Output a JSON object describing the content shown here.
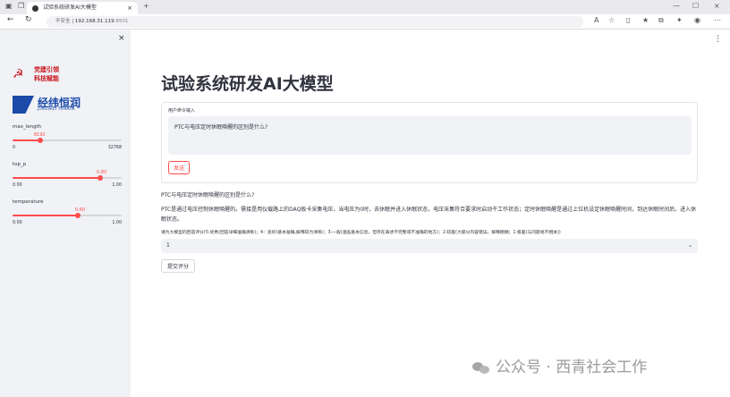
{
  "browser": {
    "tab_title": "试验系统研发AI大模型",
    "tab_close": "×",
    "url_security": "不安全",
    "url_host": "192.168.31.119",
    "url_port": ":8501",
    "nav_back": "←",
    "nav_reload": "↻",
    "win_min": "—",
    "win_max": "☐",
    "win_close": "×"
  },
  "sidebar": {
    "close": "×",
    "logo1_line1": "党建引领",
    "logo1_line2": "科技赋能",
    "logo1_icon": "☭",
    "logo2_name": "经纬恒润",
    "logo2_en": "JINGWEI HIRAIN",
    "sliders": [
      {
        "label": "max_length",
        "value": "8192",
        "min": "0",
        "max": "32768",
        "fraction": 0.25
      },
      {
        "label": "top_p",
        "value": "0.80",
        "min": "0.00",
        "max": "1.00",
        "fraction": 0.8
      },
      {
        "label": "temperature",
        "value": "0.60",
        "min": "0.00",
        "max": "1.00",
        "fraction": 0.6
      }
    ]
  },
  "main": {
    "menu": "⋮",
    "title": "试验系统研发AI大模型",
    "form_label": "用户命令输入",
    "input_value": "PTC与电压定时休眠唤醒的区别是什么?",
    "send_label": "发送",
    "question": "PTC与电压定时休眠唤醒的区别是什么?",
    "answer": "PTC是通过电压控制休眠唤醒的。需接是用仪载路上的DAQ板卡采集电压，当电压为0时，去休眠并进入休眠状态，电压采集符合要求时启动干工作状态；定时休眠唤醒是通过上位机设定休眠唤醒时间，到达休眠时间后，进入休眠状态。",
    "rating_label": "请为大模型的回答评分(5:优秀(回答详细准确清晰)；4：良好(基本准确,解释较为清晰)；3:一般(涵盖基本信息，但存在表述不完整或不准确的地方)；2:较差(大部分内容错误，解释模糊；1:极差(与问题毫不相关))",
    "rating_value": "1",
    "submit_label": "提交评分",
    "watermark": "公众号 · 西青社会工作"
  }
}
